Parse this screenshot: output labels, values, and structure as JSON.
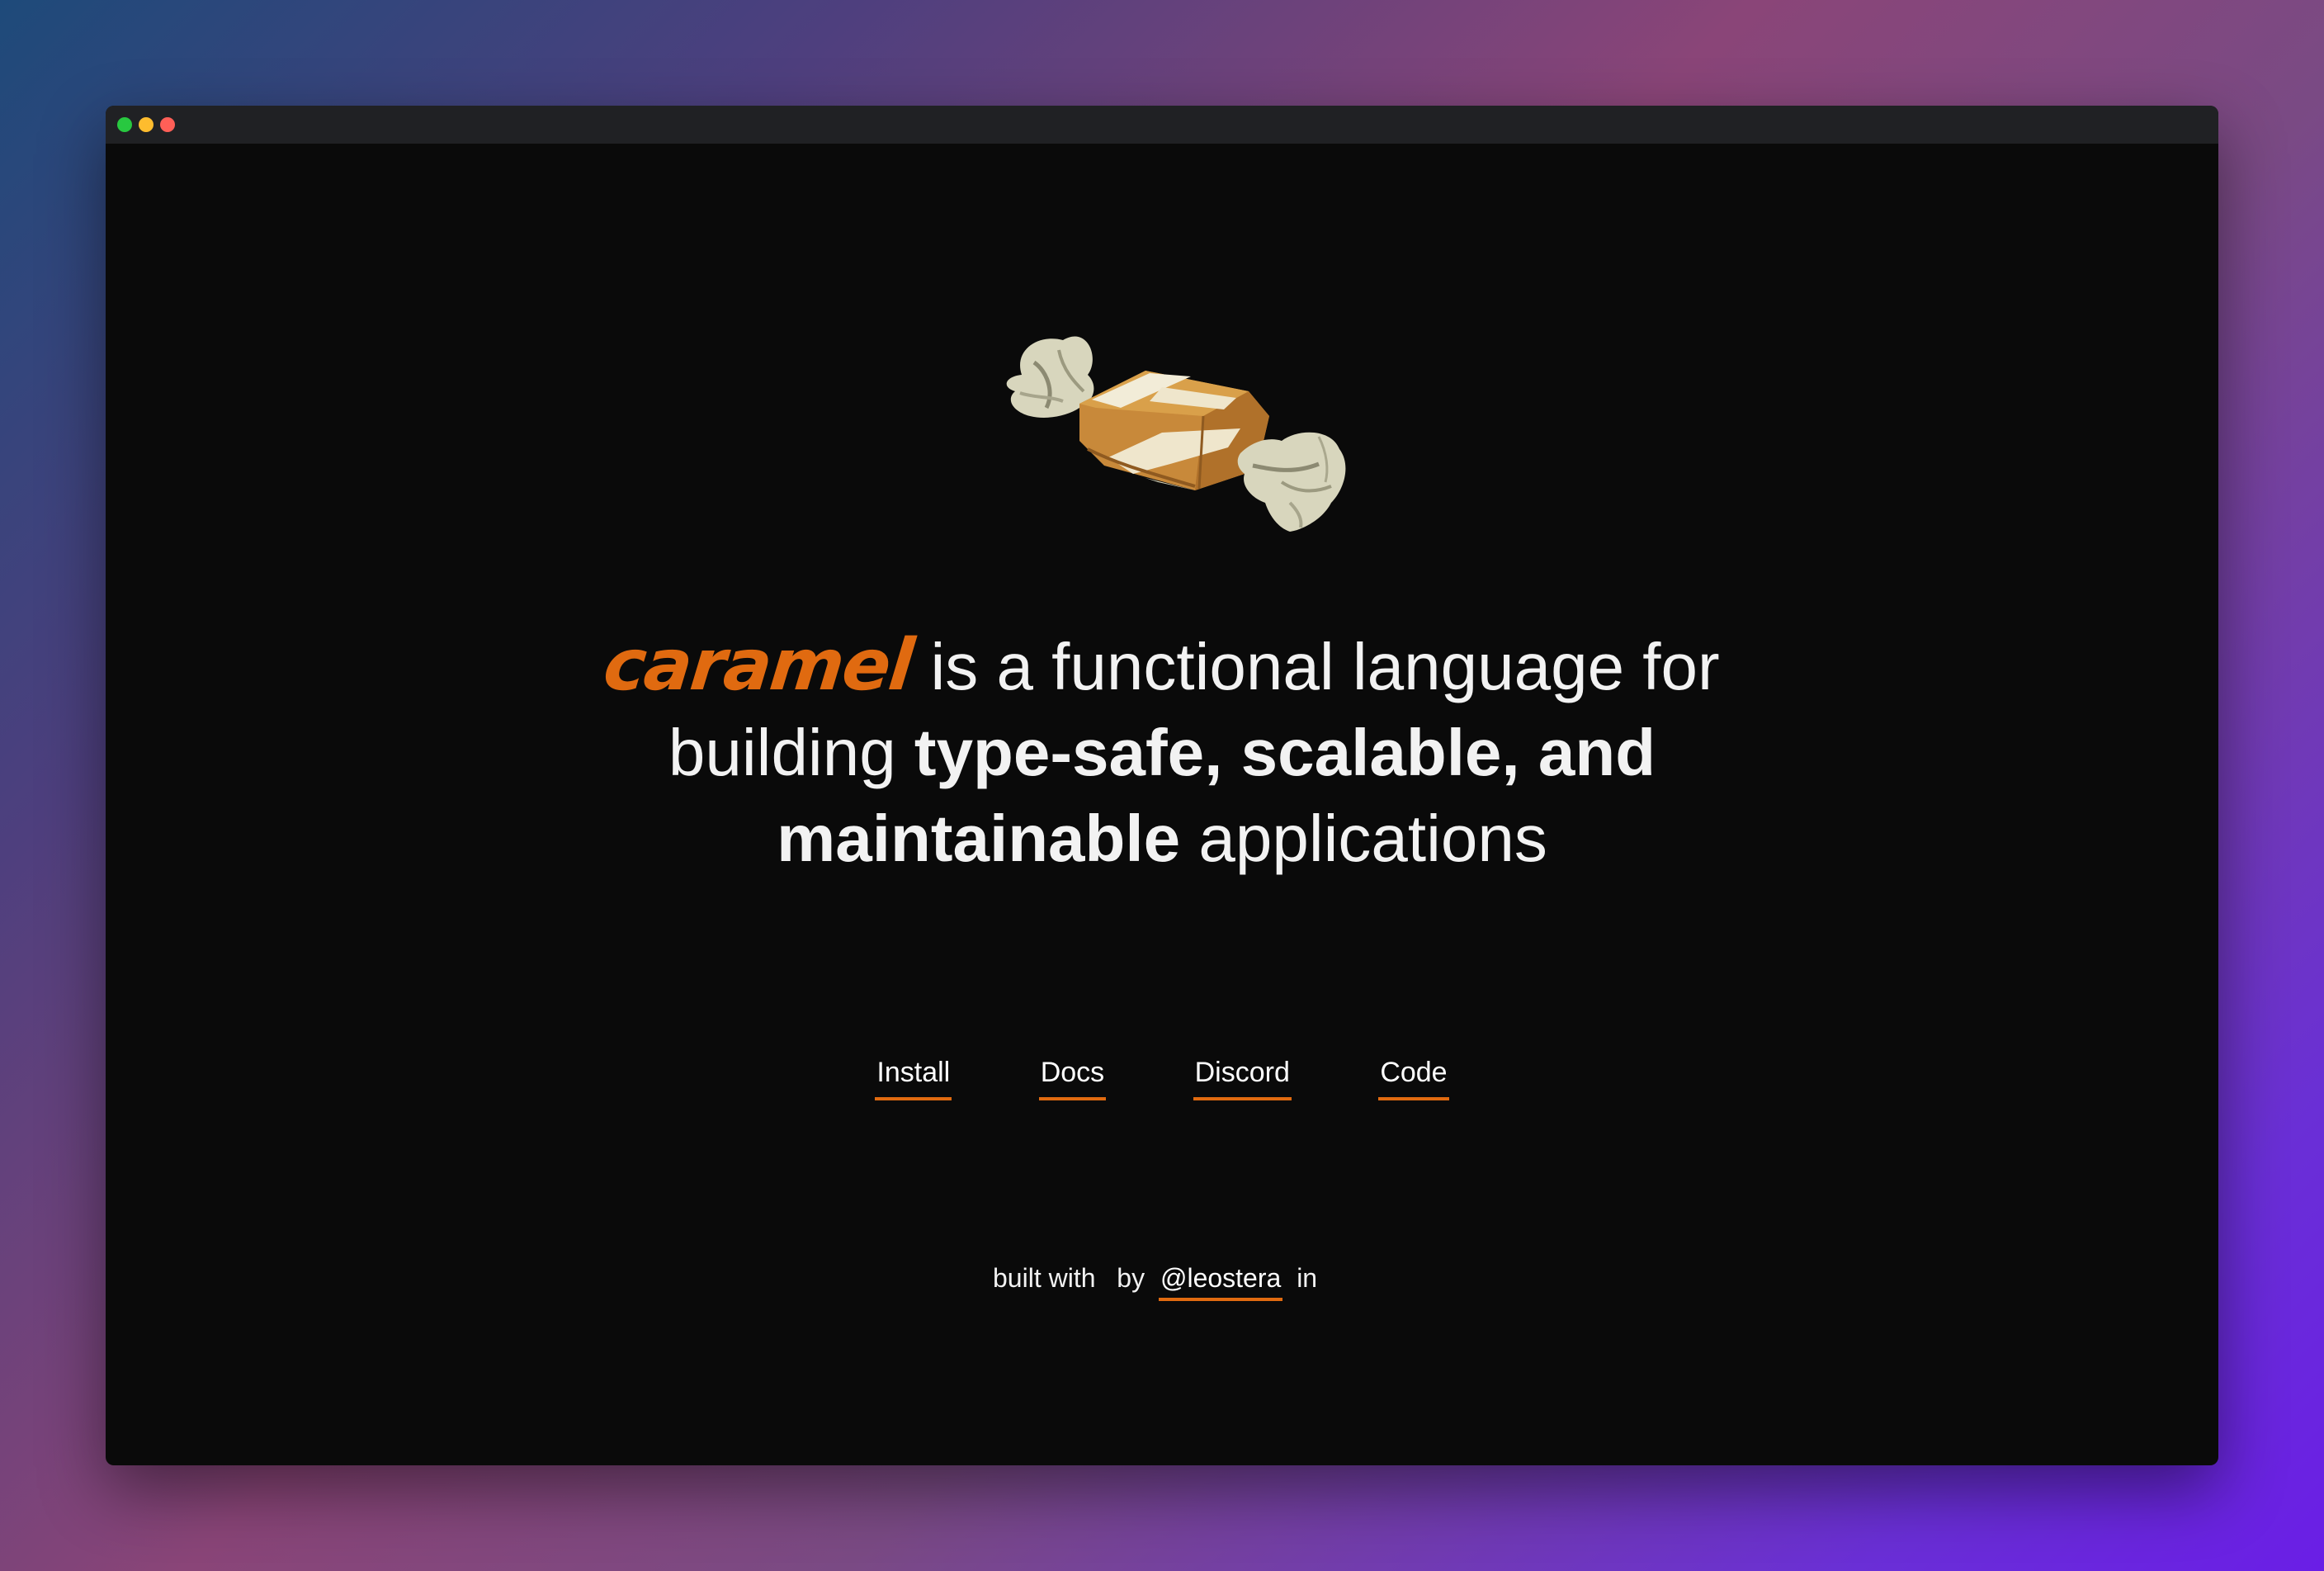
{
  "window": {
    "controls": [
      {
        "name": "green",
        "color": "#28c840"
      },
      {
        "name": "yellow",
        "color": "#febc2e"
      },
      {
        "name": "red",
        "color": "#ff5f57"
      }
    ]
  },
  "logo": {
    "icon": "caramel-candy-icon"
  },
  "headline": {
    "brand": "caramel",
    "part1": " is a functional language for building ",
    "bold1": "type-safe, scalable, and maintainable",
    "part2": " applications"
  },
  "nav": {
    "install": "Install",
    "docs": "Docs",
    "discord": "Discord",
    "code": "Code"
  },
  "footer": {
    "built_with": "built with",
    "heart_glyph": "",
    "by": "by",
    "author": "@leostera",
    "in": "in",
    "place_glyph": ""
  },
  "colors": {
    "accent": "#e06a10",
    "background": "#0a0a0a",
    "titlebar": "#202124",
    "text": "#f2f2f2"
  }
}
